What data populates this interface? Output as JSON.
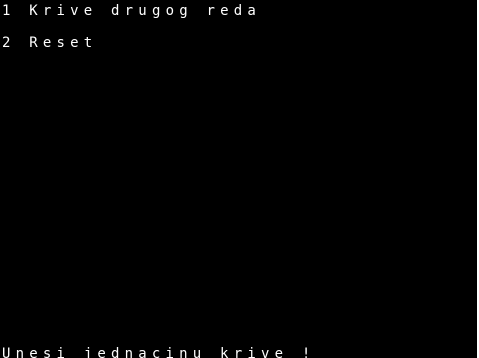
{
  "window": {
    "background": "#000000",
    "foreground": "#ffffff"
  },
  "menu": {
    "items": [
      {
        "key": "1",
        "label": "Krive drugog reda"
      },
      {
        "key": "2",
        "label": "Reset"
      }
    ]
  },
  "prompt": {
    "text": "Unesi jednacinu krive !"
  }
}
